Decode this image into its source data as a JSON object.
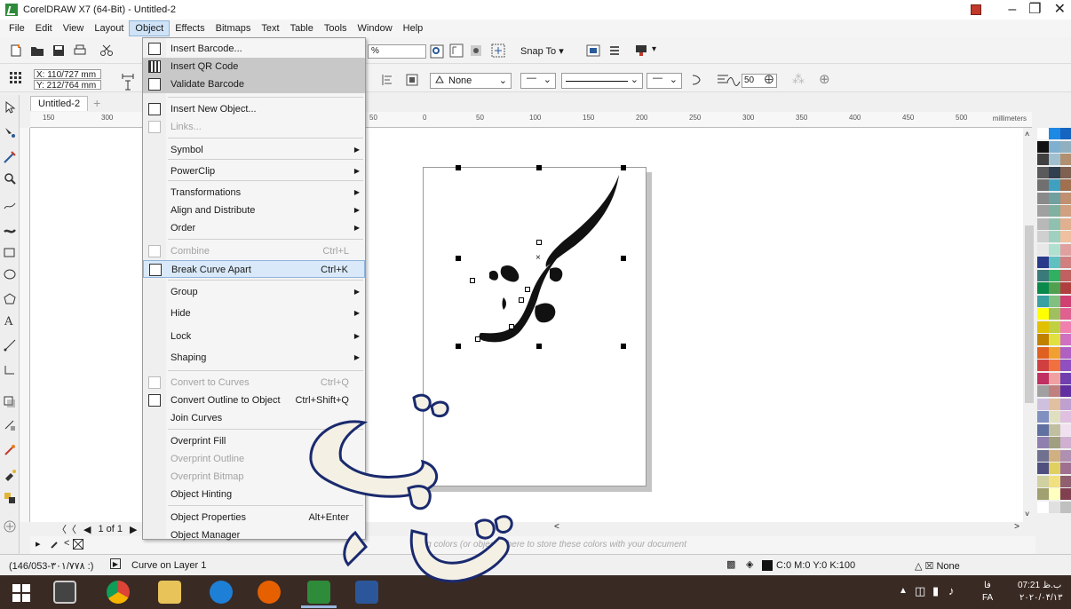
{
  "window": {
    "title": "CorelDRAW X7 (64-Bit) - Untitled-2"
  },
  "menubar": [
    "File",
    "Edit",
    "View",
    "Layout",
    "Object",
    "Effects",
    "Bitmaps",
    "Text",
    "Table",
    "Tools",
    "Window",
    "Help"
  ],
  "toolbar": {
    "x_pos": "X: 110/727 mm",
    "y_pos": "Y: 212/764 mm",
    "zoom": "%",
    "snap_to": "Snap To",
    "outline": "None",
    "angle": "50"
  },
  "document_tab": "Untitled-2",
  "ruler": {
    "h_labels": [
      "150",
      "300",
      "50",
      "0",
      "50",
      "100",
      "150",
      "200",
      "250",
      "300",
      "350",
      "400",
      "450",
      "500"
    ],
    "unit": "millimeters",
    "v_unit": "millimeters"
  },
  "object_menu": [
    {
      "label": "Insert Barcode...",
      "shortcut": "",
      "submenu": false,
      "state": "normal"
    },
    {
      "label": "Insert QR Code",
      "shortcut": "",
      "submenu": false,
      "state": "hover-gray"
    },
    {
      "label": "Validate Barcode",
      "shortcut": "",
      "submenu": false,
      "state": "hover-gray"
    },
    {
      "label": "Insert New Object...",
      "shortcut": "",
      "submenu": false,
      "state": "normal"
    },
    {
      "label": "Links...",
      "shortcut": "",
      "submenu": false,
      "state": "disabled"
    },
    {
      "label": "Symbol",
      "shortcut": "",
      "submenu": true,
      "state": "normal"
    },
    {
      "label": "PowerClip",
      "shortcut": "",
      "submenu": true,
      "state": "normal"
    },
    {
      "label": "Transformations",
      "shortcut": "",
      "submenu": true,
      "state": "normal"
    },
    {
      "label": "Align and Distribute",
      "shortcut": "",
      "submenu": true,
      "state": "normal"
    },
    {
      "label": "Order",
      "shortcut": "",
      "submenu": true,
      "state": "normal"
    },
    {
      "label": "Combine",
      "shortcut": "Ctrl+L",
      "submenu": false,
      "state": "disabled"
    },
    {
      "label": "Break Curve Apart",
      "shortcut": "Ctrl+K",
      "submenu": false,
      "state": "selected"
    },
    {
      "label": "Group",
      "shortcut": "",
      "submenu": true,
      "state": "normal"
    },
    {
      "label": "Hide",
      "shortcut": "",
      "submenu": true,
      "state": "normal"
    },
    {
      "label": "Lock",
      "shortcut": "",
      "submenu": true,
      "state": "normal"
    },
    {
      "label": "Shaping",
      "shortcut": "",
      "submenu": true,
      "state": "normal"
    },
    {
      "label": "Convert to Curves",
      "shortcut": "Ctrl+Q",
      "submenu": false,
      "state": "disabled"
    },
    {
      "label": "Convert Outline to Object",
      "shortcut": "Ctrl+Shift+Q",
      "submenu": false,
      "state": "normal"
    },
    {
      "label": "Join Curves",
      "shortcut": "",
      "submenu": false,
      "state": "normal"
    },
    {
      "label": "Overprint Fill",
      "shortcut": "",
      "submenu": false,
      "state": "normal"
    },
    {
      "label": "Overprint Outline",
      "shortcut": "",
      "submenu": false,
      "state": "disabled"
    },
    {
      "label": "Overprint Bitmap",
      "shortcut": "",
      "submenu": false,
      "state": "disabled"
    },
    {
      "label": "Object Hinting",
      "shortcut": "",
      "submenu": false,
      "state": "normal"
    },
    {
      "label": "Object Properties",
      "shortcut": "Alt+Enter",
      "submenu": false,
      "state": "normal"
    },
    {
      "label": "Object Manager",
      "shortcut": "",
      "submenu": false,
      "state": "normal"
    }
  ],
  "pagenav": {
    "page": "1 of 1"
  },
  "hint": "Drag colors (or objects) here to store these colors with your document",
  "statusbar": {
    "coords": "(146/053-۳۰۱/۷۷۸ :)",
    "object_info": "Curve on Layer 1",
    "fill": "C:0 M:0 Y:0 K:100",
    "outline": "None"
  },
  "taskbar": {
    "time": "07:21 ب.ظ",
    "date": "۲۰۲۰/۰۴/۱۳",
    "lang": "FA",
    "lang2": "فا"
  },
  "colors": {
    "menu_highlight": "#d9e9f9",
    "taskbar": "#3a2a24",
    "watermark": "#1a2a6e"
  }
}
